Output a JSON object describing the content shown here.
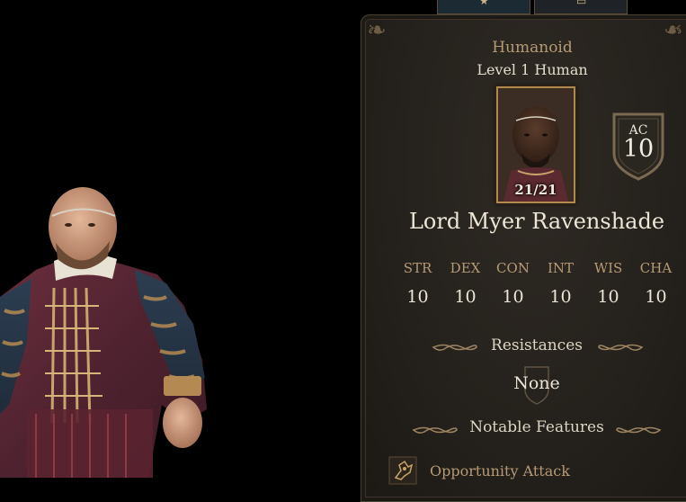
{
  "panel": {
    "creature_type": "Humanoid",
    "level_line": "Level 1 Human",
    "hp": "21/21",
    "ac_label": "AC",
    "ac_value": "10",
    "name": "Lord Myer Ravenshade"
  },
  "stats": [
    {
      "label": "STR",
      "value": "10"
    },
    {
      "label": "DEX",
      "value": "10"
    },
    {
      "label": "CON",
      "value": "10"
    },
    {
      "label": "INT",
      "value": "10"
    },
    {
      "label": "WIS",
      "value": "10"
    },
    {
      "label": "CHA",
      "value": "10"
    }
  ],
  "resistances": {
    "heading": "Resistances",
    "value": "None"
  },
  "features": {
    "heading": "Notable Features",
    "items": [
      {
        "name": "Opportunity Attack",
        "icon": "opportunity-attack-icon"
      }
    ]
  },
  "tabs": [
    {
      "icon": "star-icon"
    },
    {
      "icon": "book-icon"
    }
  ],
  "colors": {
    "accent_gold": "#b69a76",
    "panel_bg": "#2a2520",
    "text": "#ece6d8"
  }
}
